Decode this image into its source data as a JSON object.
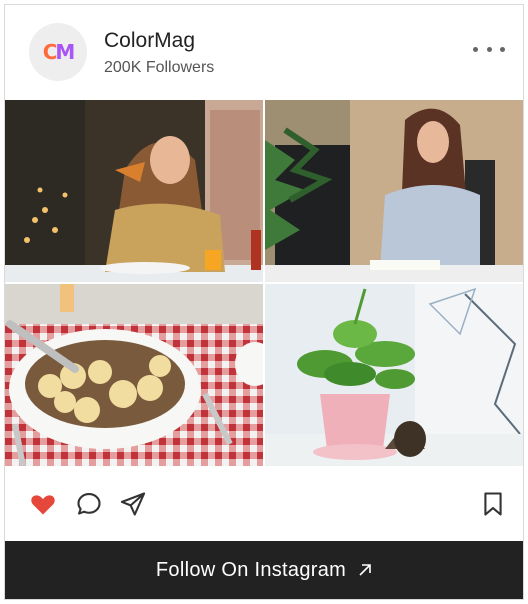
{
  "header": {
    "logo_text_c": "C",
    "logo_text_m": "M",
    "name": "ColorMag",
    "followers": "200K Followers",
    "more_icon": "ellipsis-horizontal-icon"
  },
  "grid": {
    "tiles": [
      {
        "subject": "woman eating pizza in cafe"
      },
      {
        "subject": "woman writing at desk"
      },
      {
        "subject": "bowl of cereal with banana slices"
      },
      {
        "subject": "potted plant with pine cone"
      }
    ]
  },
  "actions": {
    "like_icon": "heart-icon",
    "comment_icon": "comment-icon",
    "share_icon": "send-icon",
    "save_icon": "bookmark-icon",
    "liked": true
  },
  "follow": {
    "label": "Follow On Instagram",
    "icon": "arrow-up-right-icon"
  },
  "colors": {
    "heart": "#e5473b",
    "follow_bar": "#222222",
    "avatar_c": "#ff6a3d",
    "avatar_m": "#a855f7"
  }
}
